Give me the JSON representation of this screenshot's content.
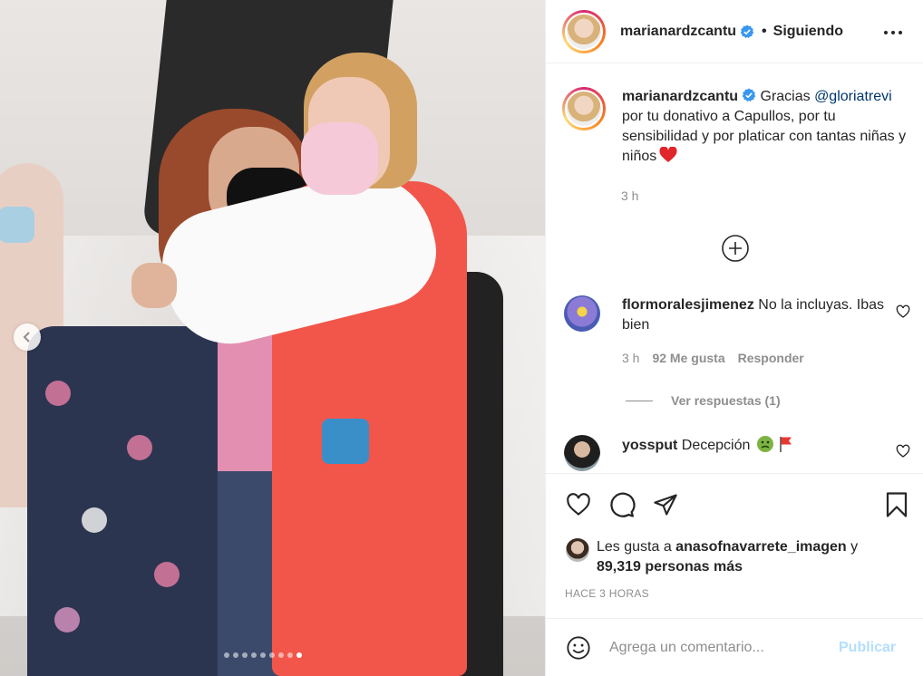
{
  "post": {
    "author": "marianardzcantu",
    "follow_status": "Siguiendo",
    "dot": "•",
    "carousel": {
      "total": 9,
      "active_index": 8
    }
  },
  "caption": {
    "username": "marianardzcantu",
    "text_before": " Gracias ",
    "mention": "@gloriatrevi",
    "text_after": " por tu donativo a Capullos, por tu sensibilidad y por platicar con tantas niñas y niños",
    "time": "3 h"
  },
  "comments": [
    {
      "username": "flormoralesjimenez",
      "text": " No la incluyas. Ibas bien",
      "time": "3 h",
      "likes": "92 Me gusta",
      "reply": "Responder",
      "view_replies": "Ver respuestas (1)"
    },
    {
      "username": "yossput",
      "text": " Decepción"
    }
  ],
  "likes": {
    "prefix": "Les gusta a ",
    "user": "anasofnavarrete_imagen",
    "mid": " y",
    "count": "89,319 personas más"
  },
  "timestamp": "HACE 3 HORAS",
  "composer": {
    "placeholder": "Agrega un comentario...",
    "publish": "Publicar"
  },
  "colors": {
    "verified": "#3897f0",
    "link": "#00376b",
    "secondary_text": "#8e8e8e",
    "publish_disabled": "#b2dffc"
  },
  "icons": [
    "verified-badge-icon",
    "more-options-icon",
    "add-circle-icon",
    "heart-icon",
    "comment-icon",
    "share-icon",
    "bookmark-icon",
    "emoji-icon",
    "chevron-left-icon"
  ]
}
